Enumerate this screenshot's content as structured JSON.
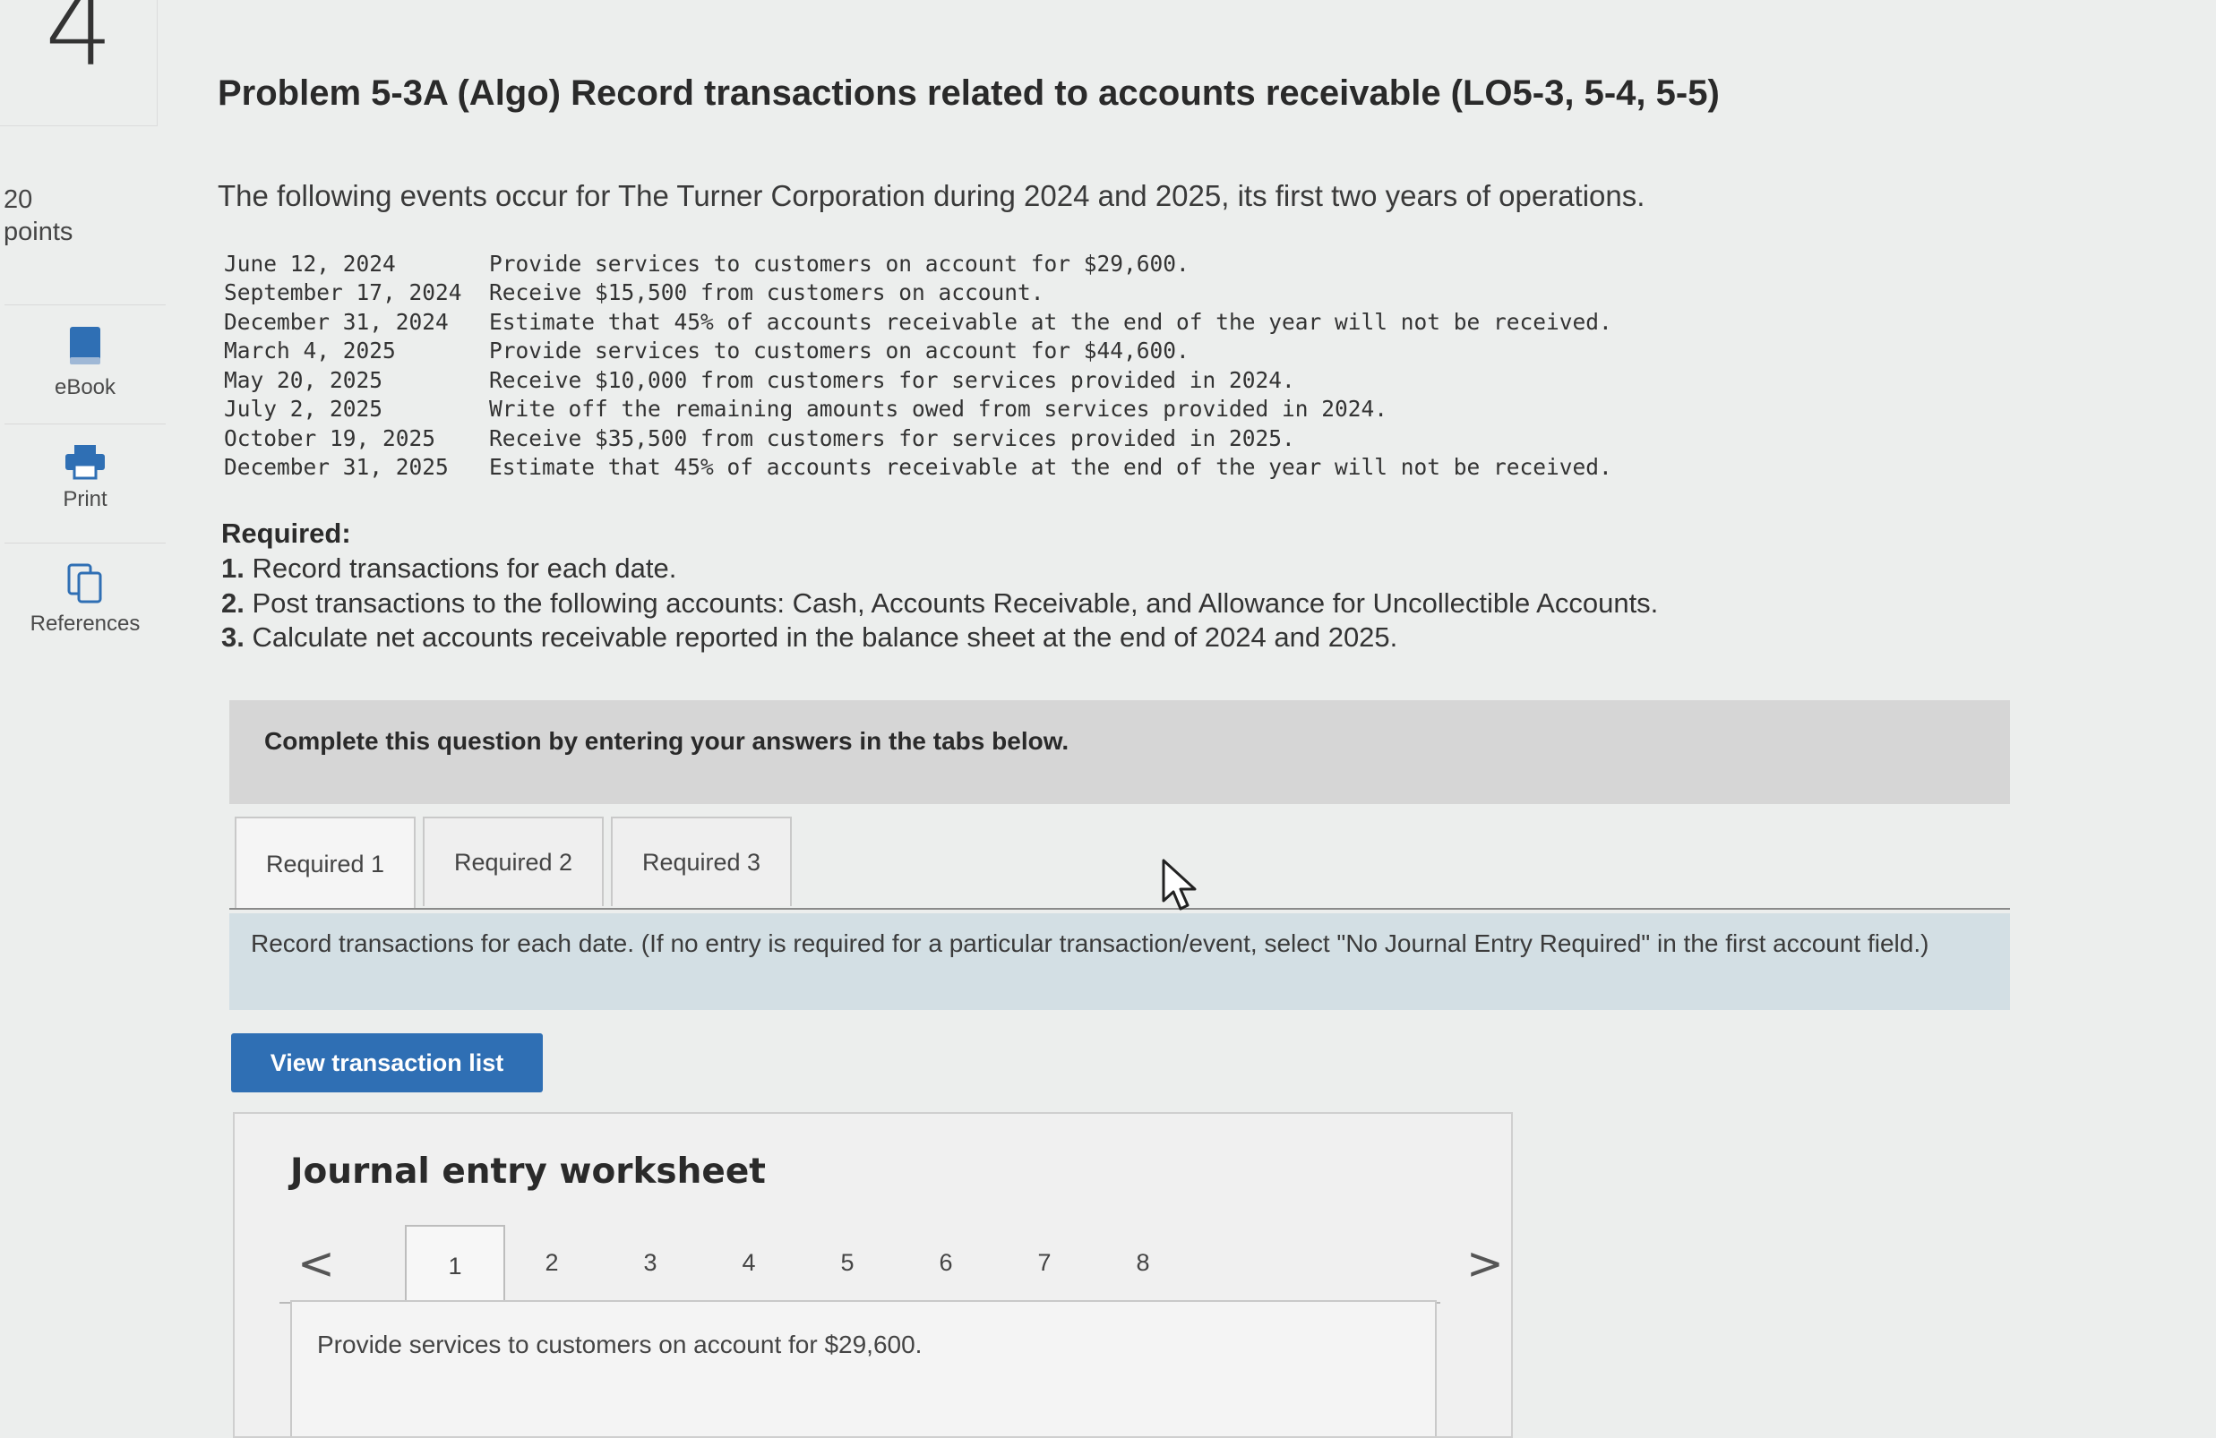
{
  "question": {
    "number": "4",
    "points_value": "20",
    "points_label": "points"
  },
  "sidebar": {
    "items": [
      {
        "label": "eBook",
        "icon": "book-icon"
      },
      {
        "label": "Print",
        "icon": "printer-icon"
      },
      {
        "label": "References",
        "icon": "copy-icon"
      }
    ]
  },
  "problem": {
    "title": "Problem 5-3A (Algo) Record transactions related to accounts receivable (LO5-3, 5-4, 5-5)",
    "intro": "The following events occur for The Turner Corporation during 2024 and 2025, its first two years of operations.",
    "events": [
      {
        "date": "June 12, 2024",
        "desc": "Provide services to customers on account for $29,600."
      },
      {
        "date": "September 17, 2024",
        "desc": "Receive $15,500 from customers on account."
      },
      {
        "date": "December 31, 2024",
        "desc": "Estimate that 45% of accounts receivable at the end of the year will not be received."
      },
      {
        "date": "March 4, 2025",
        "desc": "Provide services to customers on account for $44,600."
      },
      {
        "date": "May 20, 2025",
        "desc": "Receive $10,000 from customers for services provided in 2024."
      },
      {
        "date": "July 2, 2025",
        "desc": "Write off the remaining amounts owed from services provided in 2024."
      },
      {
        "date": "October 19, 2025",
        "desc": "Receive $35,500 from customers for services provided in 2025."
      },
      {
        "date": "December 31, 2025",
        "desc": "Estimate that 45% of accounts receivable at the end of the year will not be received."
      }
    ],
    "required_heading": "Required:",
    "required": [
      {
        "num": "1.",
        "text": "Record transactions for each date."
      },
      {
        "num": "2.",
        "text": "Post transactions to the following accounts: Cash, Accounts Receivable, and Allowance for Uncollectible Accounts."
      },
      {
        "num": "3.",
        "text": "Calculate net accounts receivable reported in the balance sheet at the end of 2024 and 2025."
      }
    ]
  },
  "banner": "Complete this question by entering your answers in the tabs below.",
  "tabs": [
    {
      "label": "Required 1"
    },
    {
      "label": "Required 2"
    },
    {
      "label": "Required 3"
    }
  ],
  "instruction": "Record transactions for each date. (If no entry is required for a particular transaction/event, select \"No Journal Entry Required\" in the first account field.)",
  "view_transaction_button": "View transaction list",
  "worksheet": {
    "title": "Journal entry worksheet",
    "pages": [
      "1",
      "2",
      "3",
      "4",
      "5",
      "6",
      "7",
      "8"
    ],
    "active_page": "1",
    "prev_symbol": "<",
    "next_symbol": ">",
    "transaction_text": "Provide services to customers on account for $29,600."
  },
  "colors": {
    "button_blue": "#2f6fb4",
    "banner_gray": "#d6d6d6",
    "instruction_blue": "#d3dfe4"
  }
}
